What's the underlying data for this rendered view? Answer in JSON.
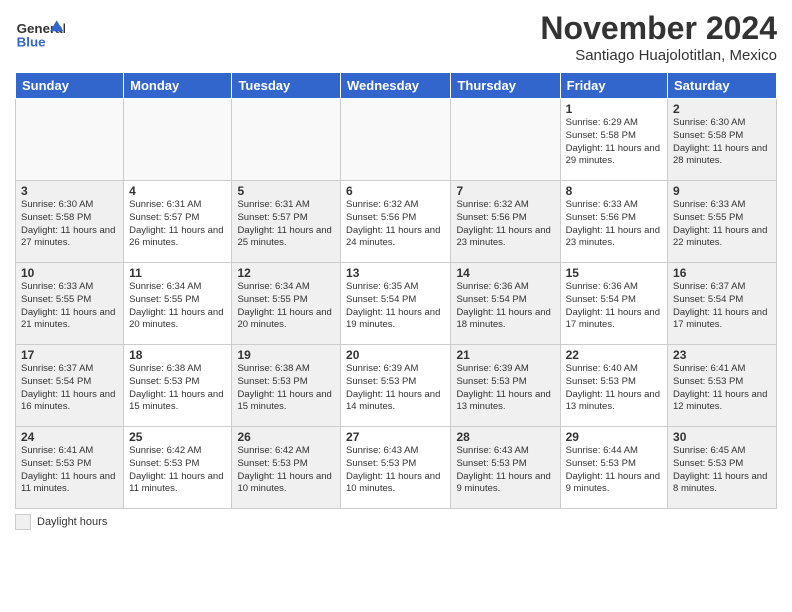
{
  "header": {
    "logo_line1": "General",
    "logo_line2": "Blue",
    "title": "November 2024",
    "subtitle": "Santiago Huajolotitlan, Mexico"
  },
  "columns": [
    "Sunday",
    "Monday",
    "Tuesday",
    "Wednesday",
    "Thursday",
    "Friday",
    "Saturday"
  ],
  "legend": {
    "label": "Daylight hours"
  },
  "weeks": [
    {
      "days": [
        {
          "num": "",
          "info": "",
          "empty": true
        },
        {
          "num": "",
          "info": "",
          "empty": true
        },
        {
          "num": "",
          "info": "",
          "empty": true
        },
        {
          "num": "",
          "info": "",
          "empty": true
        },
        {
          "num": "",
          "info": "",
          "empty": true
        },
        {
          "num": "1",
          "info": "Sunrise: 6:29 AM\nSunset: 5:58 PM\nDaylight: 11 hours\nand 29 minutes.",
          "empty": false
        },
        {
          "num": "2",
          "info": "Sunrise: 6:30 AM\nSunset: 5:58 PM\nDaylight: 11 hours\nand 28 minutes.",
          "empty": false
        }
      ]
    },
    {
      "days": [
        {
          "num": "3",
          "info": "Sunrise: 6:30 AM\nSunset: 5:58 PM\nDaylight: 11 hours\nand 27 minutes.",
          "empty": false
        },
        {
          "num": "4",
          "info": "Sunrise: 6:31 AM\nSunset: 5:57 PM\nDaylight: 11 hours\nand 26 minutes.",
          "empty": false
        },
        {
          "num": "5",
          "info": "Sunrise: 6:31 AM\nSunset: 5:57 PM\nDaylight: 11 hours\nand 25 minutes.",
          "empty": false
        },
        {
          "num": "6",
          "info": "Sunrise: 6:32 AM\nSunset: 5:56 PM\nDaylight: 11 hours\nand 24 minutes.",
          "empty": false
        },
        {
          "num": "7",
          "info": "Sunrise: 6:32 AM\nSunset: 5:56 PM\nDaylight: 11 hours\nand 23 minutes.",
          "empty": false
        },
        {
          "num": "8",
          "info": "Sunrise: 6:33 AM\nSunset: 5:56 PM\nDaylight: 11 hours\nand 23 minutes.",
          "empty": false
        },
        {
          "num": "9",
          "info": "Sunrise: 6:33 AM\nSunset: 5:55 PM\nDaylight: 11 hours\nand 22 minutes.",
          "empty": false
        }
      ]
    },
    {
      "days": [
        {
          "num": "10",
          "info": "Sunrise: 6:33 AM\nSunset: 5:55 PM\nDaylight: 11 hours\nand 21 minutes.",
          "empty": false
        },
        {
          "num": "11",
          "info": "Sunrise: 6:34 AM\nSunset: 5:55 PM\nDaylight: 11 hours\nand 20 minutes.",
          "empty": false
        },
        {
          "num": "12",
          "info": "Sunrise: 6:34 AM\nSunset: 5:55 PM\nDaylight: 11 hours\nand 20 minutes.",
          "empty": false
        },
        {
          "num": "13",
          "info": "Sunrise: 6:35 AM\nSunset: 5:54 PM\nDaylight: 11 hours\nand 19 minutes.",
          "empty": false
        },
        {
          "num": "14",
          "info": "Sunrise: 6:36 AM\nSunset: 5:54 PM\nDaylight: 11 hours\nand 18 minutes.",
          "empty": false
        },
        {
          "num": "15",
          "info": "Sunrise: 6:36 AM\nSunset: 5:54 PM\nDaylight: 11 hours\nand 17 minutes.",
          "empty": false
        },
        {
          "num": "16",
          "info": "Sunrise: 6:37 AM\nSunset: 5:54 PM\nDaylight: 11 hours\nand 17 minutes.",
          "empty": false
        }
      ]
    },
    {
      "days": [
        {
          "num": "17",
          "info": "Sunrise: 6:37 AM\nSunset: 5:54 PM\nDaylight: 11 hours\nand 16 minutes.",
          "empty": false
        },
        {
          "num": "18",
          "info": "Sunrise: 6:38 AM\nSunset: 5:53 PM\nDaylight: 11 hours\nand 15 minutes.",
          "empty": false
        },
        {
          "num": "19",
          "info": "Sunrise: 6:38 AM\nSunset: 5:53 PM\nDaylight: 11 hours\nand 15 minutes.",
          "empty": false
        },
        {
          "num": "20",
          "info": "Sunrise: 6:39 AM\nSunset: 5:53 PM\nDaylight: 11 hours\nand 14 minutes.",
          "empty": false
        },
        {
          "num": "21",
          "info": "Sunrise: 6:39 AM\nSunset: 5:53 PM\nDaylight: 11 hours\nand 13 minutes.",
          "empty": false
        },
        {
          "num": "22",
          "info": "Sunrise: 6:40 AM\nSunset: 5:53 PM\nDaylight: 11 hours\nand 13 minutes.",
          "empty": false
        },
        {
          "num": "23",
          "info": "Sunrise: 6:41 AM\nSunset: 5:53 PM\nDaylight: 11 hours\nand 12 minutes.",
          "empty": false
        }
      ]
    },
    {
      "days": [
        {
          "num": "24",
          "info": "Sunrise: 6:41 AM\nSunset: 5:53 PM\nDaylight: 11 hours\nand 11 minutes.",
          "empty": false
        },
        {
          "num": "25",
          "info": "Sunrise: 6:42 AM\nSunset: 5:53 PM\nDaylight: 11 hours\nand 11 minutes.",
          "empty": false
        },
        {
          "num": "26",
          "info": "Sunrise: 6:42 AM\nSunset: 5:53 PM\nDaylight: 11 hours\nand 10 minutes.",
          "empty": false
        },
        {
          "num": "27",
          "info": "Sunrise: 6:43 AM\nSunset: 5:53 PM\nDaylight: 11 hours\nand 10 minutes.",
          "empty": false
        },
        {
          "num": "28",
          "info": "Sunrise: 6:43 AM\nSunset: 5:53 PM\nDaylight: 11 hours\nand 9 minutes.",
          "empty": false
        },
        {
          "num": "29",
          "info": "Sunrise: 6:44 AM\nSunset: 5:53 PM\nDaylight: 11 hours\nand 9 minutes.",
          "empty": false
        },
        {
          "num": "30",
          "info": "Sunrise: 6:45 AM\nSunset: 5:53 PM\nDaylight: 11 hours\nand 8 minutes.",
          "empty": false
        }
      ]
    }
  ]
}
